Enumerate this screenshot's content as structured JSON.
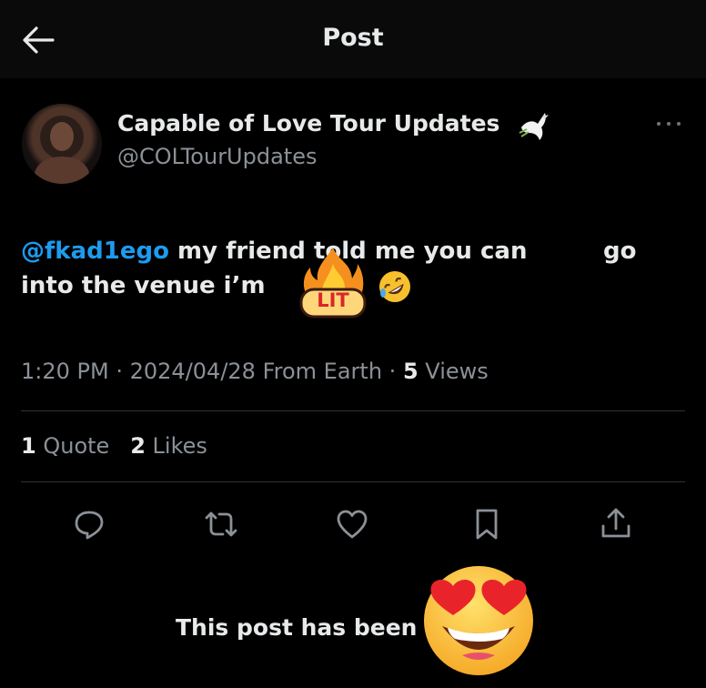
{
  "header": {
    "title": "Post",
    "back_icon": "arrow-left-icon"
  },
  "post": {
    "author": {
      "display_name": "Capable of Love Tour Updates",
      "badge_icon": "dove-icon",
      "handle": "@COLTourUpdates"
    },
    "text": {
      "mention": "@fkad1ego",
      "line1_rest": " my friend told me you can",
      "line1_end": "go",
      "line2": "into the venue i’m",
      "sticker_label": "LIT",
      "trailing_emoji": "rolling-on-floor-laughing-icon"
    },
    "meta": {
      "time": "1:20 PM",
      "separator": "·",
      "date": "2024/04/28 From Earth",
      "views_count": "5",
      "views_label": "Views"
    },
    "stats": {
      "quotes_count": "1",
      "quotes_label": "Quote",
      "likes_count": "2",
      "likes_label": "Likes"
    },
    "actions": [
      "reply-icon",
      "repost-icon",
      "like-icon",
      "bookmark-icon",
      "share-icon"
    ]
  },
  "footer": {
    "note": "This post has been",
    "emoji": "smiling-face-with-heart-eyes-icon"
  },
  "colors": {
    "background": "#000000",
    "text_primary": "#e7e9ea",
    "text_secondary": "#8b9197",
    "link": "#1d9bf0",
    "divider": "#2f3336"
  }
}
